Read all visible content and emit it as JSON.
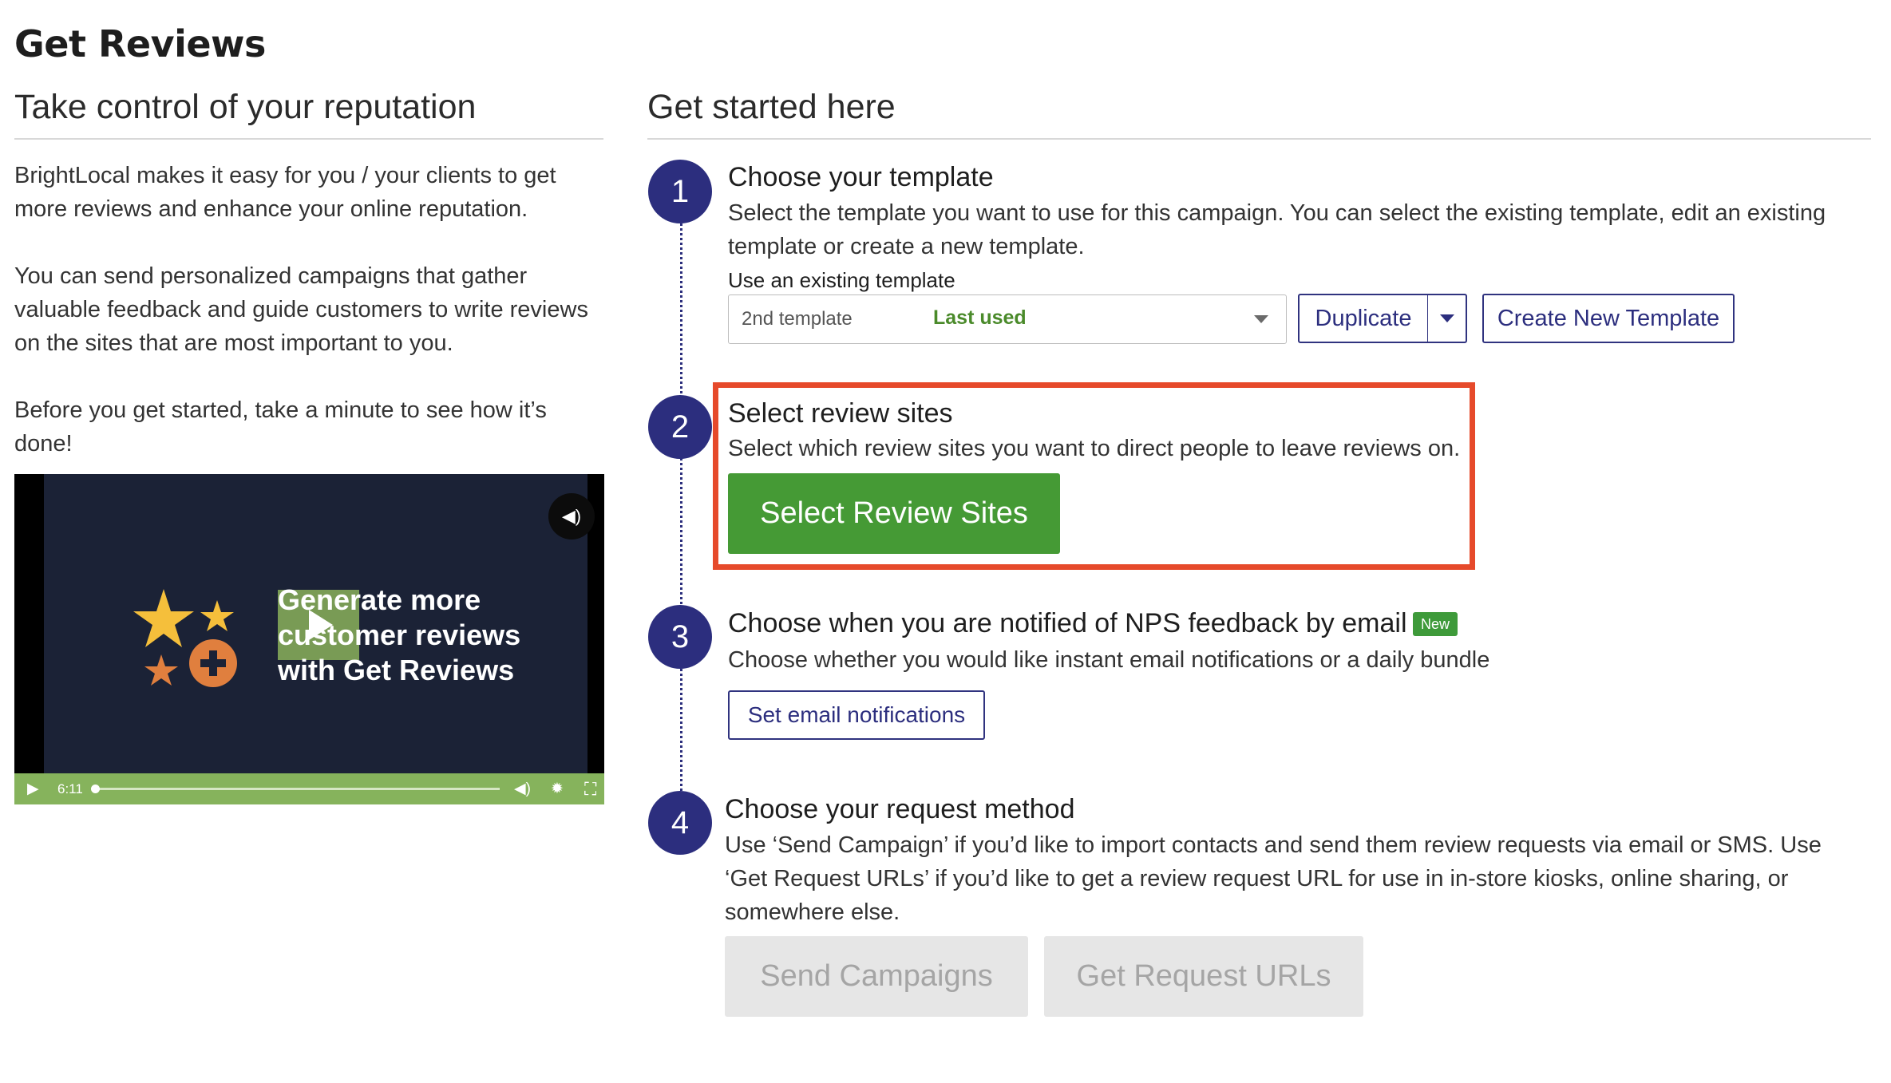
{
  "page": {
    "title": "Get Reviews"
  },
  "left": {
    "heading": "Take control of your reputation",
    "paragraphs": [
      "BrightLocal makes it easy for you / your clients to get more reviews and enhance your online reputation.",
      "You can send personalized campaigns that gather valuable feedback and guide customers to write reviews on the sites that are most important to you.",
      "Before you get started, take a minute to see how it’s done!"
    ],
    "video": {
      "overlay_text_line1": "Generate more",
      "overlay_text_line2": "customer reviews",
      "overlay_text_line3": "with Get Reviews",
      "duration": "6:11",
      "progress": 0.0,
      "accent_color": "#86b35c"
    }
  },
  "right": {
    "heading": "Get started here",
    "steps": [
      {
        "number": "1",
        "title": "Choose your template",
        "description": "Select the template you want to use for this campaign. You can select the existing template, edit an existing template or create a new template.",
        "select_label": "Use an existing template",
        "select_value": "2nd template",
        "select_tag": "Last used",
        "duplicate_label": "Duplicate",
        "create_label": "Create New Template"
      },
      {
        "number": "2",
        "title": "Select review sites",
        "description": "Select which review sites you want to direct people to leave reviews on.",
        "button_label": "Select Review Sites"
      },
      {
        "number": "3",
        "title": "Choose when you are notified of NPS feedback by email",
        "badge": "New",
        "description": "Choose whether you would like instant email notifications or a daily bundle",
        "button_label": "Set email notifications"
      },
      {
        "number": "4",
        "title": "Choose your request method",
        "description": "Use ‘Send Campaign’ if you’d like to import contacts and send them review requests via email or SMS. Use ‘Get Request URLs’ if you’d like to get a review request URL for use in in-store kiosks, online sharing, or somewhere else.",
        "send_label": "Send Campaigns",
        "urls_label": "Get Request URLs"
      }
    ]
  },
  "colors": {
    "primary": "#2c2e7e",
    "success": "#459a35",
    "highlight": "#e64a2b",
    "disabled_bg": "#e6e6e6"
  }
}
